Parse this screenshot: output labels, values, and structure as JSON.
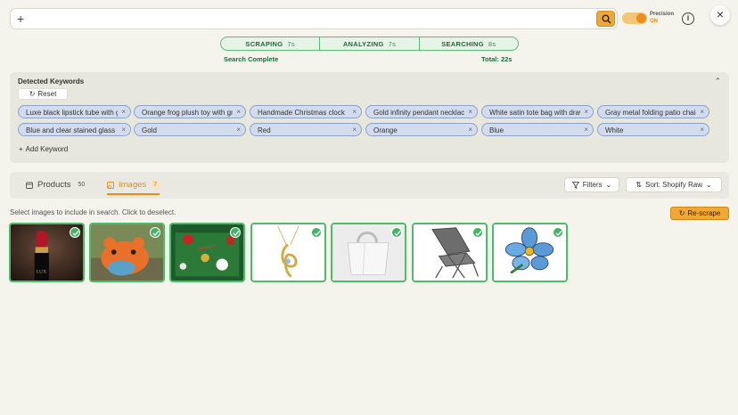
{
  "search": {
    "value": "",
    "placeholder": "",
    "plus_glyph": "+",
    "clear_glyph": "×"
  },
  "precision": {
    "label": "Precision",
    "state": "ON"
  },
  "info_glyph": "i",
  "close_glyph": "×",
  "stages": [
    {
      "name": "SCRAPING",
      "time": "7s"
    },
    {
      "name": "ANALYZING",
      "time": "7s"
    },
    {
      "name": "SEARCHING",
      "time": "8s"
    }
  ],
  "status": {
    "complete": "Search Complete",
    "total": "Total: 22s"
  },
  "keywords": {
    "title": "Detected Keywords",
    "reset_label": "Reset",
    "add_label": "Add Keyword",
    "chips": [
      "Luxe black lipstick tube with gold",
      "Orange frog plush toy with green",
      "Handmade Christmas clock",
      "Gold infinity pendant necklace",
      "White satin tote bag with drawstring",
      "Gray metal folding patio chair",
      "Blue and clear stained glass",
      "Gold",
      "Red",
      "Orange",
      "Blue",
      "White"
    ]
  },
  "tabs": {
    "products": {
      "label": "Products",
      "count": "50"
    },
    "images": {
      "label": "Images",
      "count": "7"
    }
  },
  "toolbar": {
    "filters_label": "Filters",
    "sort_label": "Sort: Shopify Raw"
  },
  "instruction": "Select images to include in search. Click to deselect.",
  "rescrape_label": "Re-scrape",
  "images": [
    {
      "name": "lipstick",
      "selected": true
    },
    {
      "name": "frog-plush",
      "selected": true
    },
    {
      "name": "christmas-clock",
      "selected": true
    },
    {
      "name": "pendant-necklace",
      "selected": true
    },
    {
      "name": "tote-bag",
      "selected": true
    },
    {
      "name": "folding-chair",
      "selected": true
    },
    {
      "name": "stained-glass-flower",
      "selected": true
    }
  ],
  "colors": {
    "accent": "#f0a733",
    "success": "#4cbb6c",
    "chip_bg": "#d2dcee"
  }
}
